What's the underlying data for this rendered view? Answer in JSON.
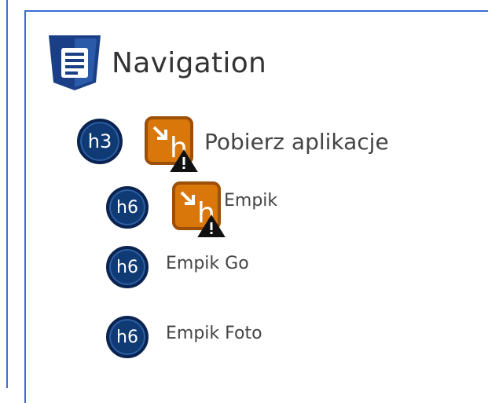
{
  "navigation": {
    "title": "Navigation",
    "icon": "list-document-icon"
  },
  "items": [
    {
      "level": "h3",
      "text": "Pobierz aplikacje",
      "warning": true
    },
    {
      "level": "h6",
      "text": "Empik",
      "warning": true
    },
    {
      "level": "h6",
      "text": "Empik Go",
      "warning": false
    },
    {
      "level": "h6",
      "text": "Empik Foto",
      "warning": false
    }
  ],
  "colors": {
    "accent_border": "#3b6fd1",
    "badge_fill": "#0f3a73",
    "warning_orange": "#d9770a"
  }
}
